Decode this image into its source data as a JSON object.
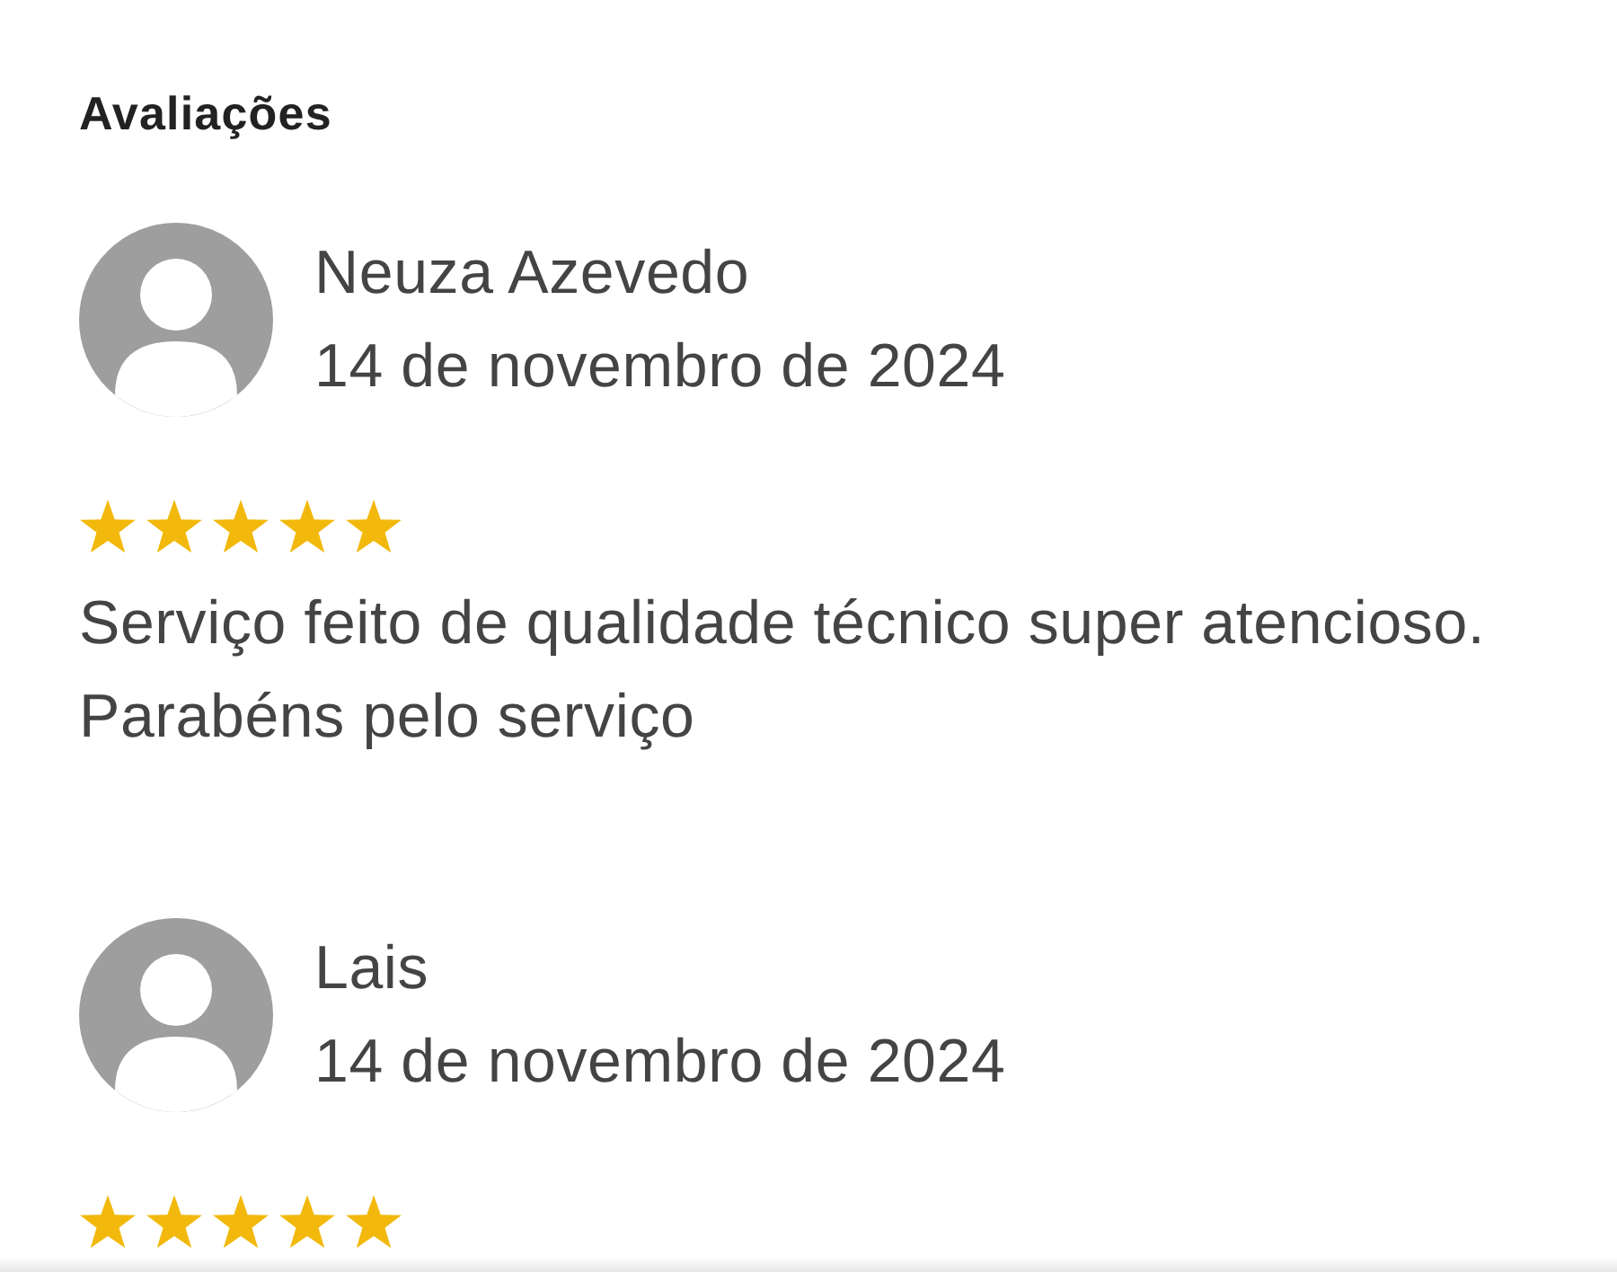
{
  "section": {
    "title": "Avaliações"
  },
  "reviews": [
    {
      "name": "Neuza Azevedo",
      "date": "14 de novembro de 2024",
      "stars": 5,
      "text": "Serviço feito de qualidade técnico super atencioso. Parabéns pelo serviço"
    },
    {
      "name": "Lais",
      "date": "14 de novembro de 2024",
      "stars": 5
    }
  ]
}
